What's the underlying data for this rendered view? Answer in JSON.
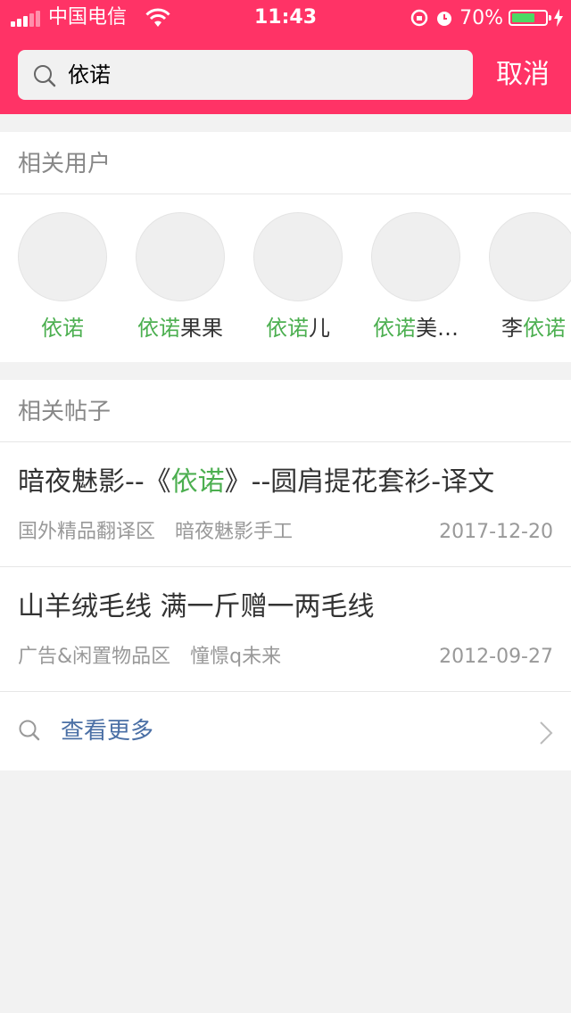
{
  "status_bar": {
    "carrier": "中国电信",
    "time": "11:43",
    "battery_percent": "70%",
    "battery_level": 0.7,
    "battery_color": "#4cd964"
  },
  "search": {
    "query": "依诺",
    "cancel_label": "取消"
  },
  "users_section": {
    "title": "相关用户",
    "users": [
      {
        "prefix": "",
        "highlight": "依诺",
        "suffix": ""
      },
      {
        "prefix": "",
        "highlight": "依诺",
        "suffix": "果果"
      },
      {
        "prefix": "",
        "highlight": "依诺",
        "suffix": "儿"
      },
      {
        "prefix": "",
        "highlight": "依诺",
        "suffix": "美…"
      },
      {
        "prefix": "李",
        "highlight": "依诺",
        "suffix": ""
      }
    ]
  },
  "posts_section": {
    "title": "相关帖子",
    "posts": [
      {
        "title_prefix": "暗夜魅影--《",
        "title_highlight": "依诺",
        "title_suffix": "》--圆肩提花套衫-译文",
        "forum": "国外精品翻译区",
        "author": "暗夜魅影手工",
        "date": "2017-12-20"
      },
      {
        "title_prefix": "山羊绒毛线 满一斤赠一两毛线",
        "title_highlight": "",
        "title_suffix": "",
        "forum": "广告&闲置物品区",
        "author": "憧憬q未来",
        "date": "2012-09-27"
      }
    ],
    "more_label": "查看更多"
  },
  "colors": {
    "header": "#ff3366",
    "highlight": "#4caf50",
    "link": "#4a6fa5"
  }
}
